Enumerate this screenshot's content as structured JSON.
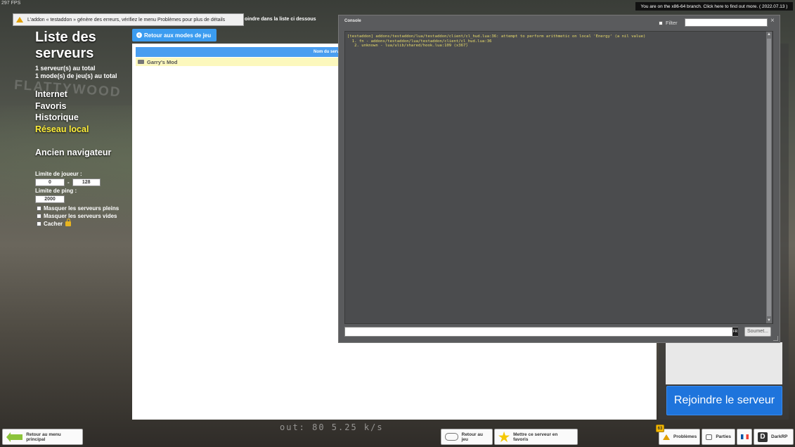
{
  "hud": {
    "fps": "297 FPS",
    "netgraph_out": "out:  80    5.25 k/s"
  },
  "notification": {
    "message": "L'addon « testaddon » génère des erreurs, vérifiez le menu Problèmes pour plus de détails",
    "behind_text": "oindre dans la liste ci dessous"
  },
  "branch_banner": "You are on the x86-64 branch. Click here to find out more. ( 2022.07.13 )",
  "sidebar": {
    "title": "Liste des serveurs",
    "servers_total": "1 serveur(s) au total",
    "gamemodes_total": "1 mode(s) de jeu(s) au total",
    "nav": [
      {
        "label": "Internet",
        "active": false
      },
      {
        "label": "Favoris",
        "active": false
      },
      {
        "label": "Historique",
        "active": false
      },
      {
        "label": "Réseau local",
        "active": true
      }
    ],
    "legacy_browser": "Ancien navigateur",
    "filters": {
      "player_limit_label": "Limite de joueur :",
      "player_min": "0",
      "player_max": "128",
      "dash": "-",
      "ping_limit_label": "Limite de ping :",
      "ping_value": "2000",
      "hide_full": "Masquer les serveurs pleins",
      "hide_empty": "Masquer les serveurs vides",
      "hidden": "Cacher"
    }
  },
  "back_to_gamemodes": "Retour aux modes de jeu",
  "server_list": {
    "column_header": "Nom du serv",
    "rows": [
      {
        "name": "Garry's Mod"
      }
    ]
  },
  "join_button": "Rejoindre le serveur",
  "console": {
    "title": "Console",
    "filter_label": "Filter",
    "close": "×",
    "lines": [
      "[testaddon] addons/testaddon/lua/testaddon/client/cl_hud.lua:36: attempt to perform arithmetic on local 'Energy' (a nil value)",
      "  1. fn - addons/testaddon/lua/testaddon/client/cl_hud.lua:36",
      "   2. unknown - lua/ulib/shared/hook.lua:109 (x367)"
    ],
    "lang": "FR",
    "submit": "Soumet..."
  },
  "bottom_bar": {
    "main_menu": "Retour au menu principal",
    "back_to_game": "Retour au jeu",
    "add_favorite": "Mettre ce serveur en favoris",
    "problems_count": "63",
    "problems": "Problèmes",
    "parties": "Parties",
    "gamemode": "DarkRP"
  },
  "colors": {
    "accent": "#3b9cf0",
    "active_nav": "#ffef3a",
    "join": "#1e74dc",
    "console_text": "#e9dc6a"
  }
}
